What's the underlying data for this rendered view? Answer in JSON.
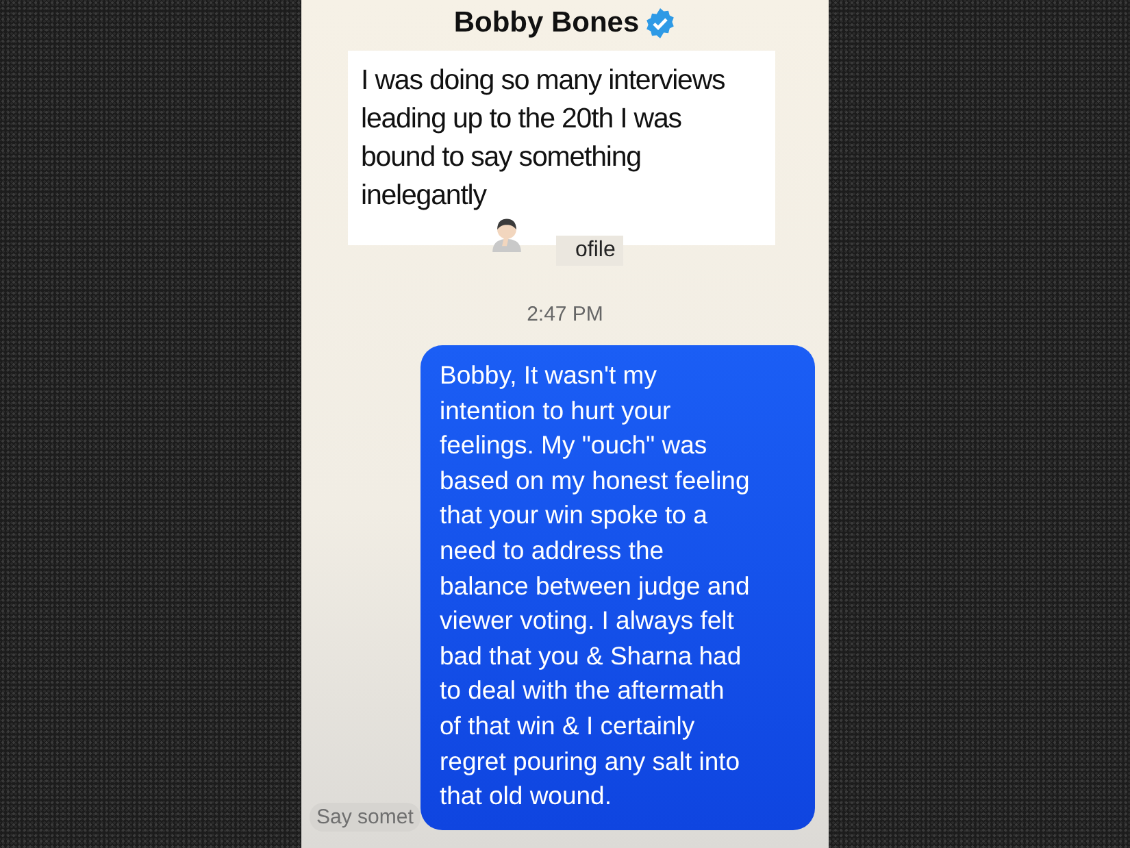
{
  "header": {
    "name": "Bobby Bones"
  },
  "caption": {
    "text": "I was doing so many interviews\nleading up to the 20th I was\nbound to say something\ninelegantly"
  },
  "fragment": "ofile",
  "timestamp": "2:47 PM",
  "messages": [
    {
      "kind": "sent",
      "text": "Bobby, It wasn't my\nintention to hurt your\nfeelings. My \"ouch\" was\nbased on my honest feeling\nthat your win spoke to a\nneed to address the\nbalance between judge and\nviewer voting. I always felt\nbad that you & Sharna had\nto deal with the aftermath\nof that win & I certainly\nregret pouring any salt into\nthat old wound."
    }
  ],
  "composer": {
    "placeholder": "Say somet"
  }
}
